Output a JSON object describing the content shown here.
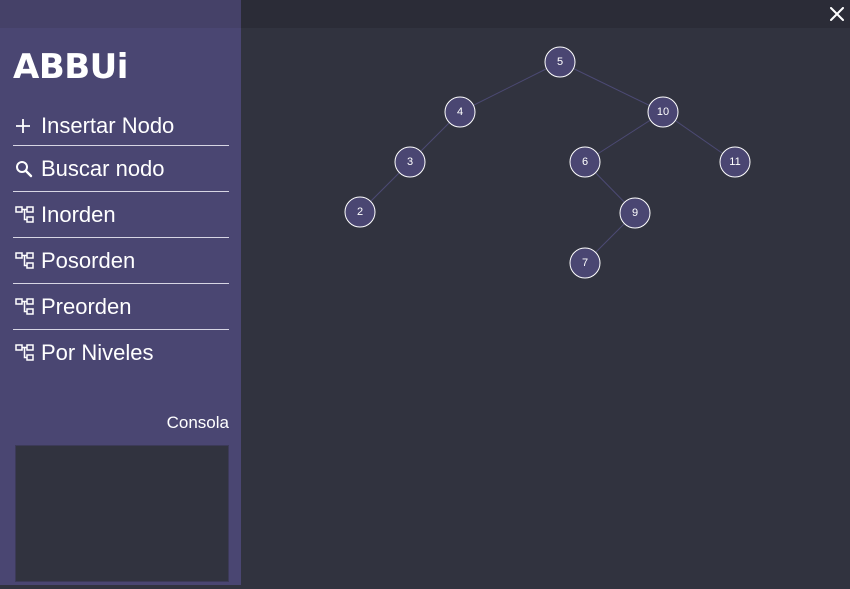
{
  "app": {
    "title": "ABBUi"
  },
  "window": {
    "close_icon": "close-icon"
  },
  "menu": [
    {
      "id": "insertar",
      "label": "Insertar Nodo",
      "icon": "plus-icon"
    },
    {
      "id": "buscar",
      "label": "Buscar nodo",
      "icon": "search-icon"
    },
    {
      "id": "inorden",
      "label": "Inorden",
      "icon": "tree-icon"
    },
    {
      "id": "posorden",
      "label": "Posorden",
      "icon": "tree-icon"
    },
    {
      "id": "preorden",
      "label": "Preorden",
      "icon": "tree-icon"
    },
    {
      "id": "niveles",
      "label": "Por Niveles",
      "icon": "tree-icon"
    }
  ],
  "console": {
    "label": "Consola",
    "content": ""
  },
  "colors": {
    "sidebar": "#4a4672",
    "canvas": "#31333f",
    "node_fill": "#4a4672",
    "edge": "#4c4a74"
  },
  "tree": {
    "root": 5,
    "nodes": [
      5,
      4,
      10,
      3,
      6,
      11,
      2,
      9,
      7
    ],
    "edges": [
      [
        5,
        4
      ],
      [
        5,
        10
      ],
      [
        4,
        3
      ],
      [
        10,
        6
      ],
      [
        10,
        11
      ],
      [
        3,
        2
      ],
      [
        6,
        9
      ],
      [
        9,
        7
      ]
    ]
  }
}
